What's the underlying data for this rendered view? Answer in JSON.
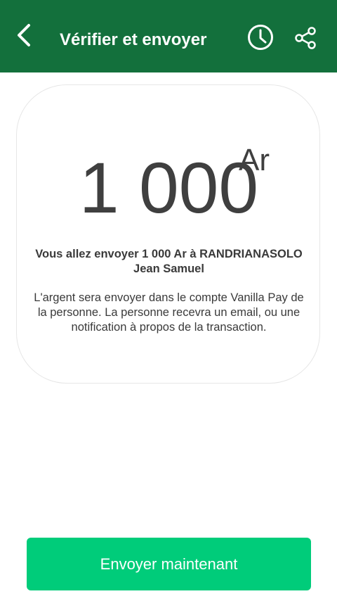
{
  "header": {
    "title": "Vérifier et envoyer",
    "icons": {
      "back": "back-arrow-icon",
      "history": "clock-icon",
      "share": "share-icon"
    }
  },
  "amount": {
    "value": "1 000",
    "currency": "Ar"
  },
  "message": {
    "summary": "Vous allez envoyer 1 000 Ar à RANDRIANASOLO Jean Samuel",
    "description": "L'argent sera envoyer dans le compte Vanilla Pay de la personne. La personne recevra un email, ou une notification à propos de la transaction."
  },
  "actions": {
    "send_label": "Envoyer maintenant"
  },
  "colors": {
    "app_bar": "#13703c",
    "button": "#00cc7a",
    "text": "#3a3a3a"
  }
}
